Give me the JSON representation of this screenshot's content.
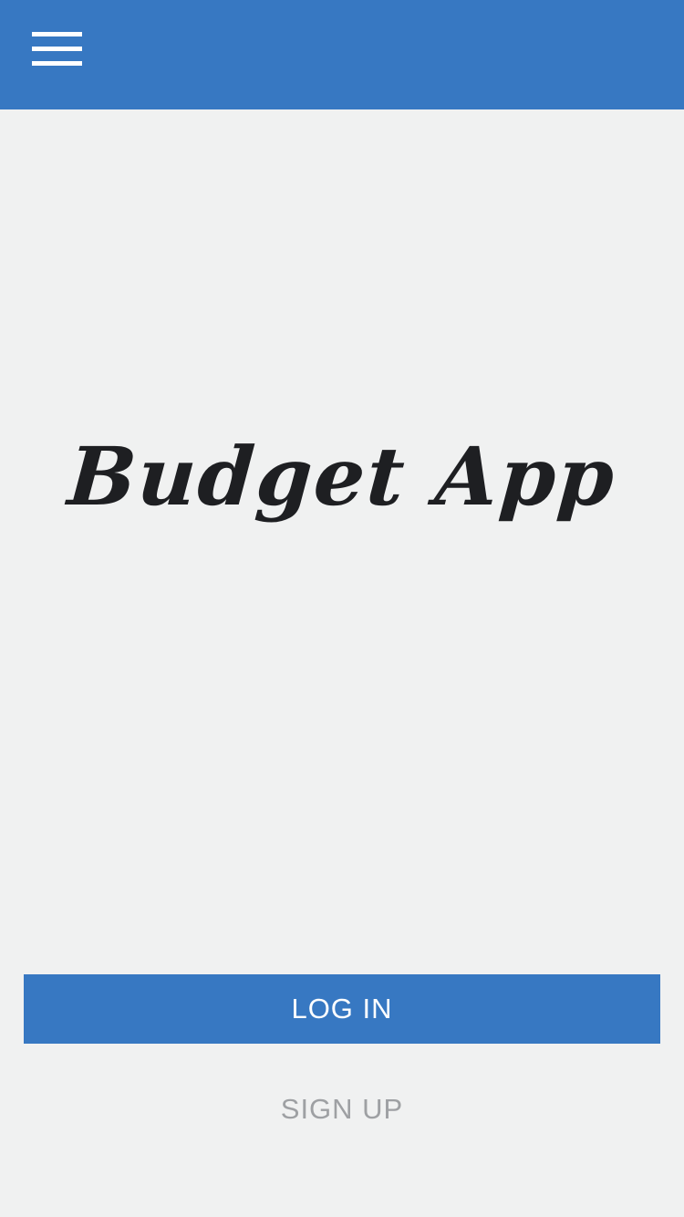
{
  "header": {
    "menu_icon": "hamburger-menu-icon",
    "background_color": "#3778c2"
  },
  "main": {
    "title": "Budget App"
  },
  "actions": {
    "login_label": "LOG IN",
    "signup_label": "SIGN UP",
    "primary_color": "#3778c2",
    "secondary_text_color": "#9ea0a3"
  },
  "page": {
    "background_color": "#f0f1f1"
  }
}
